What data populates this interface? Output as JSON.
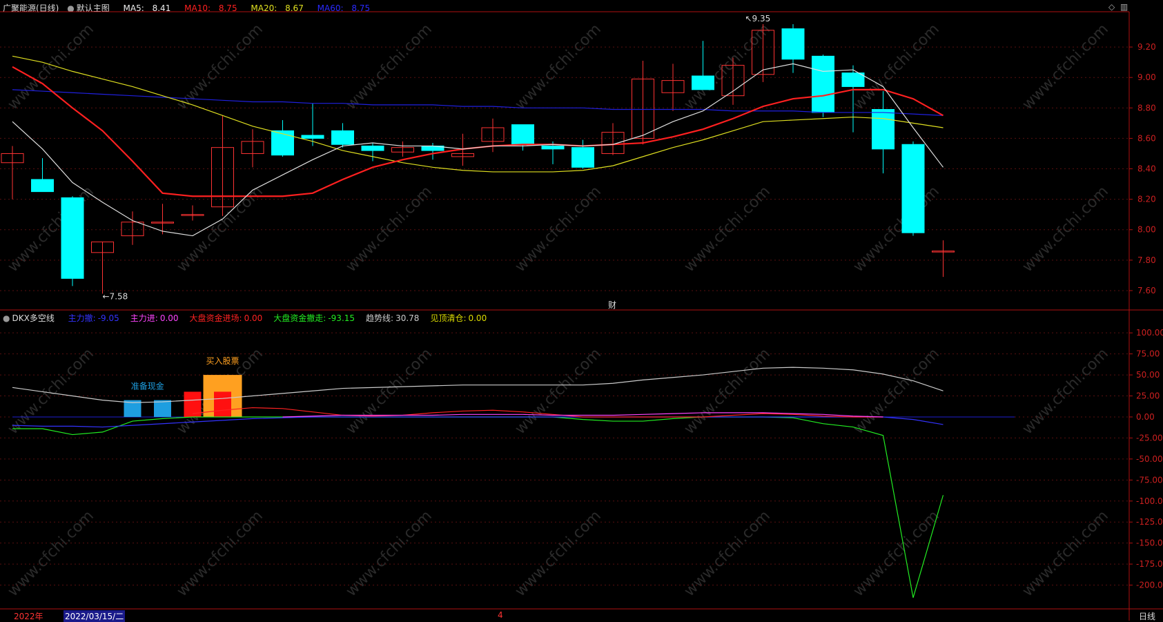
{
  "header": {
    "stock_name": "广聚能源(日线)",
    "main_chart_label": "默认主图",
    "ma5_label": "MA5:",
    "ma5_value": "8.41",
    "ma10_label": "MA10:",
    "ma10_value": "8.75",
    "ma20_label": "MA20:",
    "ma20_value": "8.67",
    "ma60_label": "MA60:",
    "ma60_value": "8.75"
  },
  "indicator_header": {
    "name": "DKX多空线",
    "items": [
      {
        "label": "主力撤:",
        "value": "-9.05",
        "color": "#3333ff"
      },
      {
        "label": "主力进:",
        "value": "0.00",
        "color": "#ff44ff"
      },
      {
        "label": "大盘资金进场:",
        "value": "0.00",
        "color": "#ff2222"
      },
      {
        "label": "大盘资金撤走:",
        "value": "-93.15",
        "color": "#22ee22"
      },
      {
        "label": "趋势线:",
        "value": "30.78",
        "color": "#cccccc"
      },
      {
        "label": "见顶清仓:",
        "value": "0.00",
        "color": "#dddd00"
      }
    ]
  },
  "controls": {
    "diamond_icon": "◇",
    "window_icon": "▥"
  },
  "footer": {
    "year": "2022年",
    "date": "2022/03/15/二",
    "month_marker": "4",
    "period": "日线"
  },
  "colors": {
    "up": "#ff3333",
    "down": "#00ffff",
    "ma5": "#e0e0e0",
    "ma10": "#ff2020",
    "ma20": "#e0e020",
    "ma60": "#2020e0",
    "axis": "#b01010"
  },
  "chart_data": [
    {
      "type": "candlestick",
      "title": "广聚能源(日线)",
      "ylim": [
        7.5,
        9.4
      ],
      "yticks": [
        "9.20",
        "9.00",
        "8.80",
        "8.60",
        "8.40",
        "8.20",
        "8.00",
        "7.80",
        "7.60"
      ],
      "candles": [
        {
          "o": 8.44,
          "h": 8.55,
          "l": 8.2,
          "c": 8.5
        },
        {
          "o": 8.33,
          "h": 8.47,
          "l": 8.25,
          "c": 8.25
        },
        {
          "o": 8.21,
          "h": 8.22,
          "l": 7.63,
          "c": 7.68
        },
        {
          "o": 7.85,
          "h": 7.92,
          "l": 7.58,
          "c": 7.92
        },
        {
          "o": 7.96,
          "h": 8.12,
          "l": 7.9,
          "c": 8.05
        },
        {
          "o": 8.05,
          "h": 8.17,
          "l": 7.97,
          "c": 8.05
        },
        {
          "o": 8.1,
          "h": 8.16,
          "l": 8.06,
          "c": 8.1
        },
        {
          "o": 8.15,
          "h": 8.75,
          "l": 8.09,
          "c": 8.54
        },
        {
          "o": 8.5,
          "h": 8.66,
          "l": 8.41,
          "c": 8.58
        },
        {
          "o": 8.65,
          "h": 8.72,
          "l": 8.48,
          "c": 8.49
        },
        {
          "o": 8.62,
          "h": 8.83,
          "l": 8.55,
          "c": 8.6
        },
        {
          "o": 8.65,
          "h": 8.7,
          "l": 8.54,
          "c": 8.56
        },
        {
          "o": 8.55,
          "h": 8.57,
          "l": 8.45,
          "c": 8.52
        },
        {
          "o": 8.51,
          "h": 8.58,
          "l": 8.48,
          "c": 8.54
        },
        {
          "o": 8.55,
          "h": 8.57,
          "l": 8.46,
          "c": 8.52
        },
        {
          "o": 8.48,
          "h": 8.63,
          "l": 8.42,
          "c": 8.5
        },
        {
          "o": 8.58,
          "h": 8.73,
          "l": 8.51,
          "c": 8.67
        },
        {
          "o": 8.69,
          "h": 8.69,
          "l": 8.52,
          "c": 8.56
        },
        {
          "o": 8.55,
          "h": 8.58,
          "l": 8.43,
          "c": 8.53
        },
        {
          "o": 8.54,
          "h": 8.59,
          "l": 8.4,
          "c": 8.41
        },
        {
          "o": 8.5,
          "h": 8.7,
          "l": 8.49,
          "c": 8.64
        },
        {
          "o": 8.6,
          "h": 9.11,
          "l": 8.56,
          "c": 8.99
        },
        {
          "o": 8.9,
          "h": 9.09,
          "l": 8.78,
          "c": 8.98
        },
        {
          "o": 9.01,
          "h": 9.24,
          "l": 8.92,
          "c": 8.92
        },
        {
          "o": 8.88,
          "h": 9.13,
          "l": 8.82,
          "c": 9.08
        },
        {
          "o": 9.02,
          "h": 9.35,
          "l": 8.97,
          "c": 9.31
        },
        {
          "o": 9.32,
          "h": 9.35,
          "l": 9.03,
          "c": 9.12
        },
        {
          "o": 9.14,
          "h": 9.15,
          "l": 8.74,
          "c": 8.77
        },
        {
          "o": 9.03,
          "h": 9.08,
          "l": 8.64,
          "c": 8.94
        },
        {
          "o": 8.79,
          "h": 8.91,
          "l": 8.37,
          "c": 8.53
        },
        {
          "o": 8.56,
          "h": 8.58,
          "l": 7.96,
          "c": 7.98
        },
        {
          "o": 7.86,
          "h": 7.93,
          "l": 7.69,
          "c": 7.86
        }
      ],
      "ma5": [
        8.71,
        8.53,
        8.31,
        8.18,
        8.06,
        7.99,
        7.96,
        8.07,
        8.26,
        8.36,
        8.46,
        8.55,
        8.57,
        8.55,
        8.55,
        8.53,
        8.55,
        8.55,
        8.56,
        8.55,
        8.56,
        8.62,
        8.71,
        8.78,
        8.91,
        9.05,
        9.09,
        9.04,
        9.05,
        8.94,
        8.67,
        8.41
      ],
      "ma10": [
        9.07,
        8.96,
        8.8,
        8.65,
        8.45,
        8.24,
        8.22,
        8.22,
        8.22,
        8.22,
        8.24,
        8.33,
        8.41,
        8.46,
        8.5,
        8.53,
        8.55,
        8.56,
        8.56,
        8.55,
        8.56,
        8.57,
        8.61,
        8.66,
        8.73,
        8.81,
        8.86,
        8.88,
        8.92,
        8.92,
        8.86,
        8.75
      ],
      "ma20": [
        9.14,
        9.1,
        9.04,
        8.99,
        8.94,
        8.88,
        8.82,
        8.75,
        8.68,
        8.63,
        8.58,
        8.52,
        8.48,
        8.44,
        8.41,
        8.39,
        8.38,
        8.38,
        8.38,
        8.39,
        8.42,
        8.48,
        8.54,
        8.59,
        8.65,
        8.71,
        8.72,
        8.73,
        8.74,
        8.73,
        8.7,
        8.67
      ],
      "ma60": [
        8.92,
        8.91,
        8.9,
        8.89,
        8.88,
        8.87,
        8.86,
        8.85,
        8.84,
        8.84,
        8.83,
        8.83,
        8.82,
        8.82,
        8.82,
        8.81,
        8.81,
        8.8,
        8.8,
        8.8,
        8.79,
        8.79,
        8.79,
        8.79,
        8.78,
        8.78,
        8.78,
        8.77,
        8.77,
        8.77,
        8.76,
        8.75
      ],
      "annotations": [
        {
          "index": 25,
          "value": 9.35,
          "text": "9.35"
        },
        {
          "index": 3,
          "value": 7.58,
          "text": "7.58"
        },
        {
          "index": 20,
          "text": "财"
        }
      ]
    },
    {
      "type": "line",
      "title": "DKX多空线",
      "ylim": [
        -225,
        110
      ],
      "yticks": [
        "100.00",
        "75.00",
        "50.00",
        "25.00",
        "0.00",
        "-25.00",
        "-50.00",
        "-75.00",
        "-100.00",
        "-125.00",
        "-150.00",
        "-175.00",
        "-200.00"
      ],
      "series": [
        {
          "name": "趋势线",
          "color": "#cccccc",
          "values": [
            35,
            30,
            25,
            20,
            17,
            18,
            20,
            22,
            25,
            28,
            31,
            34,
            35,
            36,
            37,
            38,
            38,
            38,
            38,
            38,
            40,
            44,
            47,
            50,
            54,
            58,
            59,
            58,
            56,
            51,
            43,
            31
          ]
        },
        {
          "name": "大盘资金撤走",
          "color": "#22ee22",
          "values": [
            -14,
            -14,
            -21,
            -18,
            -5,
            -2,
            0,
            0,
            0,
            0,
            0,
            0,
            0,
            0,
            0,
            0,
            0,
            0,
            0,
            -3,
            -5,
            -5,
            -2,
            0,
            0,
            0,
            -1,
            -8,
            -12,
            -22,
            -215,
            -93
          ]
        },
        {
          "name": "主力撤",
          "color": "#3333ff",
          "values": [
            -10,
            -11,
            -11,
            -12,
            -10,
            -8,
            -6,
            -4,
            -2,
            -1,
            0,
            0,
            0,
            0,
            0,
            0,
            0,
            0,
            0,
            0,
            0,
            0,
            0,
            0,
            0,
            0,
            0,
            0,
            0,
            0,
            -3,
            -9
          ]
        },
        {
          "name": "大盘资金进场",
          "color": "#ff2222",
          "values": [
            null,
            null,
            null,
            null,
            null,
            null,
            4,
            8,
            11,
            10,
            6,
            2,
            1,
            2,
            5,
            7,
            8,
            6,
            3,
            0,
            0,
            0,
            0,
            0,
            2,
            4,
            3,
            1,
            0,
            0,
            null,
            null
          ]
        },
        {
          "name": "主力进",
          "color": "#ff44ff",
          "values": [
            null,
            null,
            null,
            null,
            null,
            null,
            null,
            null,
            null,
            0,
            1,
            2,
            2,
            2,
            2,
            3,
            3,
            3,
            2,
            2,
            2,
            3,
            4,
            5,
            5,
            5,
            4,
            3,
            1,
            0,
            null,
            null
          ]
        }
      ],
      "bars": [
        {
          "index": 4,
          "value": 20,
          "color": "#1e9ee0",
          "kind": "准备现金"
        },
        {
          "index": 5,
          "value": 20,
          "color": "#1e9ee0",
          "kind": "准备现金"
        },
        {
          "index": 6,
          "value": 30,
          "color": "#ff1010",
          "kind": "大盘资金进场"
        },
        {
          "index": 7,
          "value": 50,
          "color": "#ffa020",
          "kind": "买入股票",
          "wide": true
        },
        {
          "index": 7,
          "value": 30,
          "color": "#ff1010",
          "kind": "大盘资金进场"
        }
      ],
      "annotations": [
        {
          "index": 4.5,
          "value": 30,
          "text": "准备现金",
          "color": "#1e9ee0"
        },
        {
          "index": 7,
          "value": 60,
          "text": "买入股票",
          "color": "#ffa020"
        }
      ]
    }
  ]
}
